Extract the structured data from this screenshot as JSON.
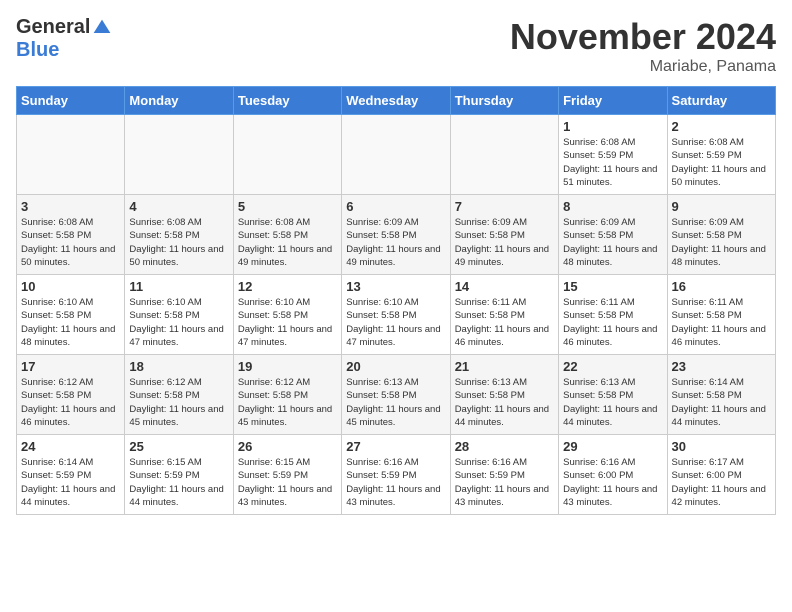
{
  "logo": {
    "general": "General",
    "blue": "Blue"
  },
  "title": "November 2024",
  "location": "Mariabe, Panama",
  "days_of_week": [
    "Sunday",
    "Monday",
    "Tuesday",
    "Wednesday",
    "Thursday",
    "Friday",
    "Saturday"
  ],
  "weeks": [
    [
      {
        "day": "",
        "info": ""
      },
      {
        "day": "",
        "info": ""
      },
      {
        "day": "",
        "info": ""
      },
      {
        "day": "",
        "info": ""
      },
      {
        "day": "",
        "info": ""
      },
      {
        "day": "1",
        "info": "Sunrise: 6:08 AM\nSunset: 5:59 PM\nDaylight: 11 hours and 51 minutes."
      },
      {
        "day": "2",
        "info": "Sunrise: 6:08 AM\nSunset: 5:59 PM\nDaylight: 11 hours and 50 minutes."
      }
    ],
    [
      {
        "day": "3",
        "info": "Sunrise: 6:08 AM\nSunset: 5:58 PM\nDaylight: 11 hours and 50 minutes."
      },
      {
        "day": "4",
        "info": "Sunrise: 6:08 AM\nSunset: 5:58 PM\nDaylight: 11 hours and 50 minutes."
      },
      {
        "day": "5",
        "info": "Sunrise: 6:08 AM\nSunset: 5:58 PM\nDaylight: 11 hours and 49 minutes."
      },
      {
        "day": "6",
        "info": "Sunrise: 6:09 AM\nSunset: 5:58 PM\nDaylight: 11 hours and 49 minutes."
      },
      {
        "day": "7",
        "info": "Sunrise: 6:09 AM\nSunset: 5:58 PM\nDaylight: 11 hours and 49 minutes."
      },
      {
        "day": "8",
        "info": "Sunrise: 6:09 AM\nSunset: 5:58 PM\nDaylight: 11 hours and 48 minutes."
      },
      {
        "day": "9",
        "info": "Sunrise: 6:09 AM\nSunset: 5:58 PM\nDaylight: 11 hours and 48 minutes."
      }
    ],
    [
      {
        "day": "10",
        "info": "Sunrise: 6:10 AM\nSunset: 5:58 PM\nDaylight: 11 hours and 48 minutes."
      },
      {
        "day": "11",
        "info": "Sunrise: 6:10 AM\nSunset: 5:58 PM\nDaylight: 11 hours and 47 minutes."
      },
      {
        "day": "12",
        "info": "Sunrise: 6:10 AM\nSunset: 5:58 PM\nDaylight: 11 hours and 47 minutes."
      },
      {
        "day": "13",
        "info": "Sunrise: 6:10 AM\nSunset: 5:58 PM\nDaylight: 11 hours and 47 minutes."
      },
      {
        "day": "14",
        "info": "Sunrise: 6:11 AM\nSunset: 5:58 PM\nDaylight: 11 hours and 46 minutes."
      },
      {
        "day": "15",
        "info": "Sunrise: 6:11 AM\nSunset: 5:58 PM\nDaylight: 11 hours and 46 minutes."
      },
      {
        "day": "16",
        "info": "Sunrise: 6:11 AM\nSunset: 5:58 PM\nDaylight: 11 hours and 46 minutes."
      }
    ],
    [
      {
        "day": "17",
        "info": "Sunrise: 6:12 AM\nSunset: 5:58 PM\nDaylight: 11 hours and 46 minutes."
      },
      {
        "day": "18",
        "info": "Sunrise: 6:12 AM\nSunset: 5:58 PM\nDaylight: 11 hours and 45 minutes."
      },
      {
        "day": "19",
        "info": "Sunrise: 6:12 AM\nSunset: 5:58 PM\nDaylight: 11 hours and 45 minutes."
      },
      {
        "day": "20",
        "info": "Sunrise: 6:13 AM\nSunset: 5:58 PM\nDaylight: 11 hours and 45 minutes."
      },
      {
        "day": "21",
        "info": "Sunrise: 6:13 AM\nSunset: 5:58 PM\nDaylight: 11 hours and 44 minutes."
      },
      {
        "day": "22",
        "info": "Sunrise: 6:13 AM\nSunset: 5:58 PM\nDaylight: 11 hours and 44 minutes."
      },
      {
        "day": "23",
        "info": "Sunrise: 6:14 AM\nSunset: 5:58 PM\nDaylight: 11 hours and 44 minutes."
      }
    ],
    [
      {
        "day": "24",
        "info": "Sunrise: 6:14 AM\nSunset: 5:59 PM\nDaylight: 11 hours and 44 minutes."
      },
      {
        "day": "25",
        "info": "Sunrise: 6:15 AM\nSunset: 5:59 PM\nDaylight: 11 hours and 44 minutes."
      },
      {
        "day": "26",
        "info": "Sunrise: 6:15 AM\nSunset: 5:59 PM\nDaylight: 11 hours and 43 minutes."
      },
      {
        "day": "27",
        "info": "Sunrise: 6:16 AM\nSunset: 5:59 PM\nDaylight: 11 hours and 43 minutes."
      },
      {
        "day": "28",
        "info": "Sunrise: 6:16 AM\nSunset: 5:59 PM\nDaylight: 11 hours and 43 minutes."
      },
      {
        "day": "29",
        "info": "Sunrise: 6:16 AM\nSunset: 6:00 PM\nDaylight: 11 hours and 43 minutes."
      },
      {
        "day": "30",
        "info": "Sunrise: 6:17 AM\nSunset: 6:00 PM\nDaylight: 11 hours and 42 minutes."
      }
    ]
  ]
}
